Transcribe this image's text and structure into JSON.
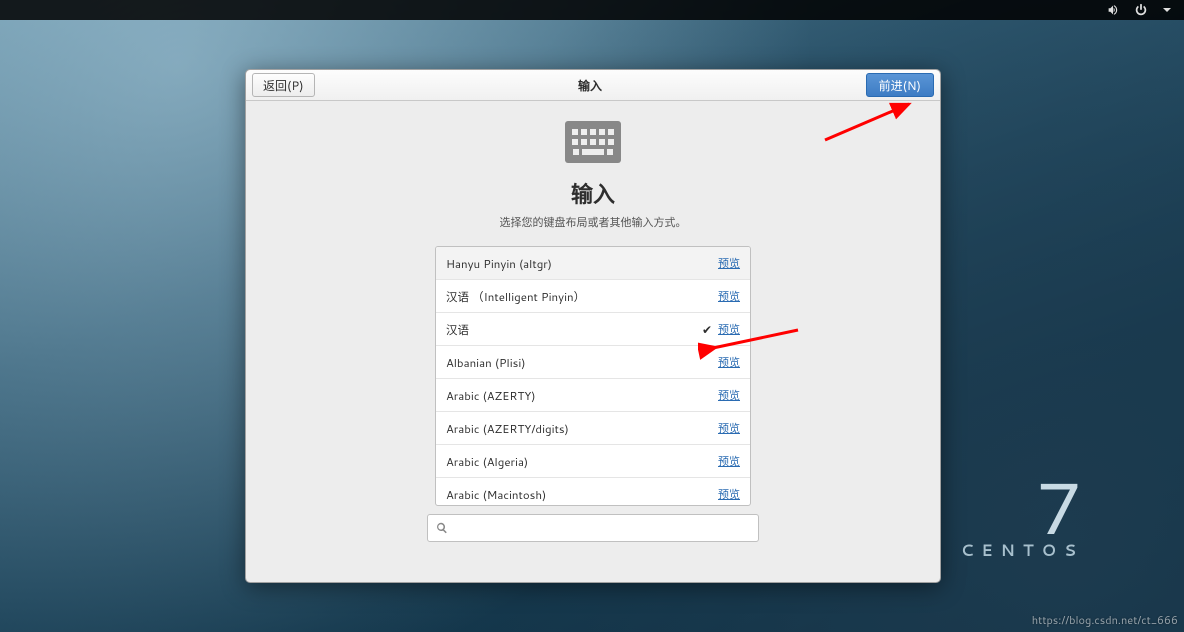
{
  "panel": {
    "sound_icon": "sound-icon",
    "power_icon": "power-icon",
    "menu_icon": "menu-arrow-icon"
  },
  "dialog": {
    "back_label": "返回(P)",
    "title": "输入",
    "next_label": "前进(N)",
    "page_title": "输入",
    "page_subtitle": "选择您的键盘布局或者其他输入方式。",
    "preview_label": "预览",
    "items": [
      {
        "label": "Hanyu Pinyin (altgr)",
        "selected": false
      },
      {
        "label": "汉语 （Intelligent Pinyin）",
        "selected": false
      },
      {
        "label": "汉语",
        "selected": true
      },
      {
        "label": "Albanian (Plisi)",
        "selected": false
      },
      {
        "label": "Arabic (AZERTY)",
        "selected": false
      },
      {
        "label": "Arabic (AZERTY/digits)",
        "selected": false
      },
      {
        "label": "Arabic (Algeria)",
        "selected": false
      },
      {
        "label": "Arabic (Macintosh)",
        "selected": false
      }
    ],
    "search_placeholder": ""
  },
  "brand": {
    "number": "7",
    "name": "CENTOS"
  },
  "watermark": "https://blog.csdn.net/ct_666"
}
